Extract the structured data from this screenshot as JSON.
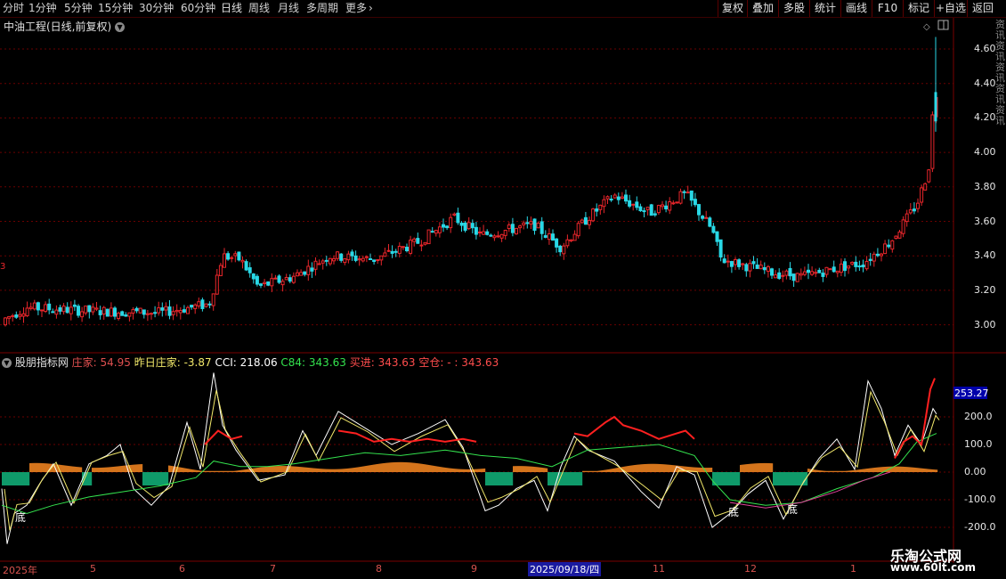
{
  "toolbar": {
    "periods": [
      "分时",
      "1分钟",
      "5分钟",
      "15分钟",
      "30分钟",
      "60分钟",
      "日线",
      "周线",
      "月线",
      "多周期",
      "更多"
    ],
    "active_period": "日线",
    "more_arrow": "›",
    "right_buttons": [
      "复权",
      "叠加",
      "多股",
      "统计",
      "画线",
      "F10",
      "标记",
      "+自选",
      "返回"
    ]
  },
  "chart": {
    "title": "中油工程(日线,前复权)",
    "price_axis": [
      "4.60",
      "4.40",
      "4.20",
      "4.00",
      "3.80",
      "3.60",
      "3.40",
      "3.20",
      "3.00"
    ],
    "left_price_tag": "3",
    "up_color": "#e8262b",
    "down_color": "#29d8e6"
  },
  "indicator": {
    "name": "股朋指标网",
    "items": [
      {
        "label": "庄家: 54.95",
        "color": "#e05050"
      },
      {
        "label": "昨日庄家: -3.87",
        "color": "#f2e86a"
      },
      {
        "label": "CCI: 218.06",
        "color": "#ffffff"
      },
      {
        "label": "C84: 343.63",
        "color": "#34e34e"
      },
      {
        "label": "买进: 343.63",
        "color": "#ff4d4d"
      },
      {
        "label": "空仓: -  : 343.63",
        "color": "#ff4d4d"
      }
    ],
    "axis": [
      "200.0",
      "100.0",
      "0.00",
      "-100.0",
      "-200.0"
    ],
    "highlight_value": "253.27",
    "bottom_marks": [
      "底",
      "底",
      "底"
    ]
  },
  "xaxis": {
    "labels": [
      "2025年",
      "5",
      "6",
      "7",
      "8",
      "9",
      "2025/09/18/四",
      "11",
      "12",
      "1"
    ]
  },
  "watermark": {
    "line1": "乐淘公式网",
    "line2": "www.60lt.com"
  },
  "sidebar_text": "资讯资讯资讯资讯资讯"
}
